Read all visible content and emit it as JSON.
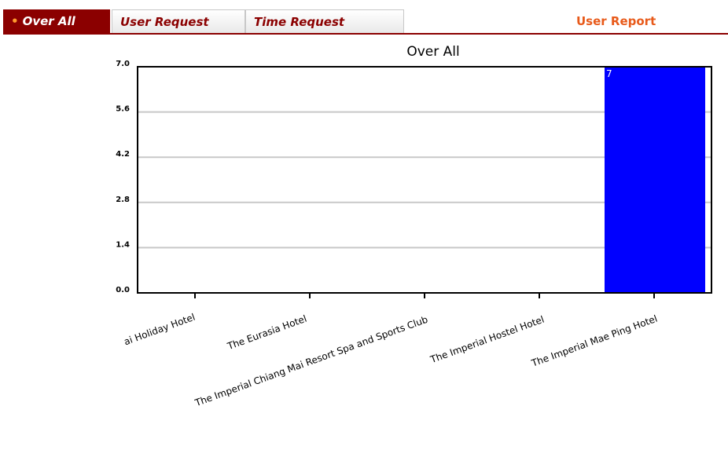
{
  "tabs": [
    {
      "label": "Over All",
      "active": true
    },
    {
      "label": "User Request",
      "active": false
    },
    {
      "label": "Time Request",
      "active": false
    }
  ],
  "report_link": "User Report",
  "colors": {
    "accent": "#8b0000",
    "bar": "#0000ff",
    "link": "#e85a1a"
  },
  "chart_data": {
    "type": "bar",
    "title": "Over All",
    "categories": [
      "ai Holiday Hotel",
      "The Eurasia Hotel",
      "The Imperial Chiang Mai Resort Spa and Sports Club",
      "The Imperial Hostel Hotel",
      "The Imperial Mae Ping Hotel"
    ],
    "values": [
      0,
      0,
      0,
      0,
      7
    ],
    "data_labels": [
      "",
      "",
      "",
      "",
      "7"
    ],
    "yticks": [
      "0.0",
      "1.4",
      "2.8",
      "4.2",
      "5.6",
      "7.0"
    ],
    "ylim": [
      0,
      7
    ],
    "grid": true,
    "legend": "none",
    "xlabel": "",
    "ylabel": ""
  }
}
